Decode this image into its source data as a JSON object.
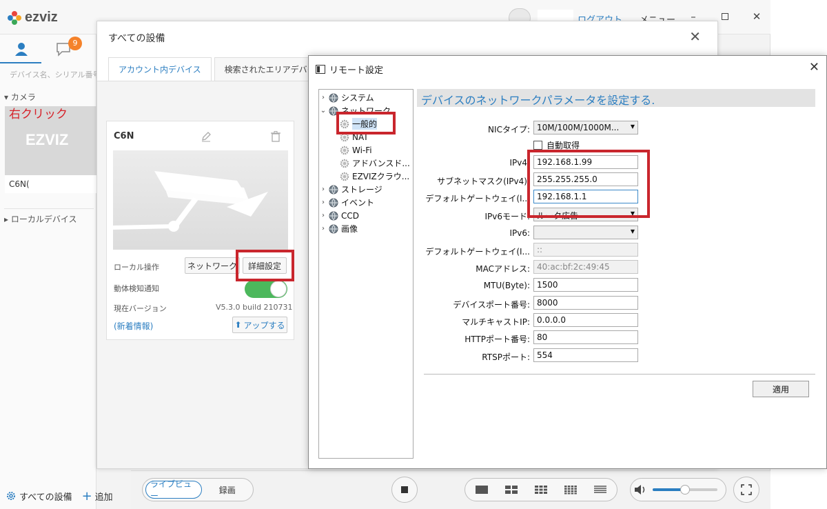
{
  "app": {
    "brand": "ezviz",
    "logout": "ログアウト",
    "menu": "メニュー",
    "message_count": "9",
    "search_placeholder": "デバイス名、シリアル番号",
    "camera_section": "カメラ",
    "annotation_right_click": "右クリック",
    "camera_name": "C6N(",
    "camera_thumb_logo": "EZVIZ",
    "local_devices": "ローカルデバイス",
    "all_devices": "すべての設備",
    "add": "追加"
  },
  "bottom_bar": {
    "live_view": "ライブビュー",
    "record": "録画"
  },
  "devices_dialog": {
    "title": "すべての設備",
    "tabs": [
      "アカウント内デバイス",
      "検索されたエリアデバイス"
    ],
    "card": {
      "name": "C6N(",
      "local_op_label": "ローカル操作",
      "network_button": "ネットワーク",
      "detail_button": "詳細設定",
      "motion_label": "動体検知通知",
      "version_label": "現在バージョン",
      "version_value": "V5.3.0 build 210731",
      "news_link": "(新着情報)",
      "update_button": "アップする"
    }
  },
  "remote_dialog": {
    "title": "リモート設定",
    "header": "デバイスのネットワークパラメータを設定する.",
    "tree": [
      {
        "label": "システム",
        "level": 0,
        "chevron": ">"
      },
      {
        "label": "ネットワーク",
        "level": 0,
        "chevron": "v"
      },
      {
        "label": "一般的",
        "level": 1,
        "selected": true
      },
      {
        "label": "NAT",
        "level": 1
      },
      {
        "label": "Wi-Fi",
        "level": 1
      },
      {
        "label": "アドバンスド...",
        "level": 1
      },
      {
        "label": "EZVIZクラウ...",
        "level": 1
      },
      {
        "label": "ストレージ",
        "level": 0,
        "chevron": ">"
      },
      {
        "label": "イベント",
        "level": 0,
        "chevron": ">"
      },
      {
        "label": "CCD",
        "level": 0,
        "chevron": ">"
      },
      {
        "label": "画像",
        "level": 0,
        "chevron": ">"
      }
    ],
    "nic_type": {
      "label": "NICタイプ:",
      "value": "10M/100M/1000M..."
    },
    "auto_obtain": "自動取得",
    "ipv4": {
      "label": "IPv4:",
      "value": "192.168.1.99"
    },
    "subnet": {
      "label": "サブネットマスク(IPv4):",
      "value": "255.255.255.0"
    },
    "gateway": {
      "label": "デフォルトゲートウェイ(I...",
      "value": "192.168.1.1"
    },
    "ipv6_mode": {
      "label": "IPv6モード:",
      "value": "ルータ広告"
    },
    "ipv6": {
      "label": "IPv6:",
      "value": ""
    },
    "gateway_v6": {
      "label": "デフォルトゲートウェイ(I...",
      "value": "::"
    },
    "mac": {
      "label": "MACアドレス:",
      "value": "40:ac:bf:2c:49:45"
    },
    "mtu": {
      "label": "MTU(Byte):",
      "value": "1500"
    },
    "device_port": {
      "label": "デバイスポート番号:",
      "value": "8000"
    },
    "multicast": {
      "label": "マルチキャストIP:",
      "value": "0.0.0.0"
    },
    "http_port": {
      "label": "HTTPポート番号:",
      "value": "80"
    },
    "rtsp_port": {
      "label": "RTSPポート:",
      "value": "554"
    },
    "apply": "適用"
  },
  "colors": {
    "accent": "#2b7ec1",
    "highlight": "#c9262d",
    "badge": "#f5822a",
    "toggle_on": "#4cb85c"
  }
}
